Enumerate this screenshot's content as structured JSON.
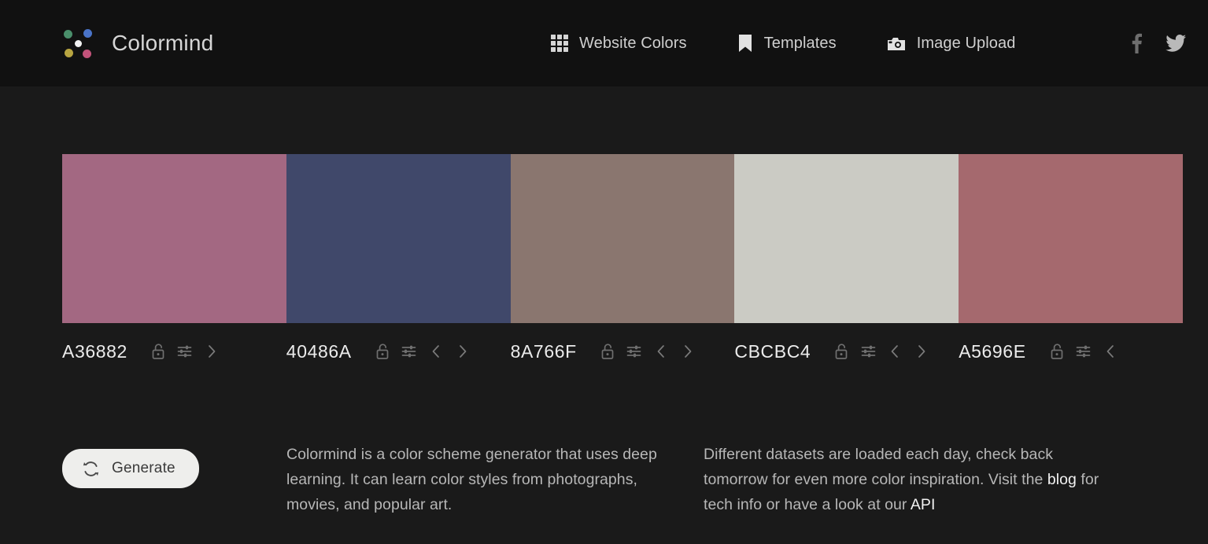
{
  "header": {
    "brand": {
      "name": "Colormind",
      "logo_icon": "colormind-dots-logo",
      "dot_colors": [
        "#4a8f6b",
        "#4a74c8",
        "#b8a541",
        "#c2537a",
        "#f2f2f2"
      ]
    },
    "nav": [
      {
        "label": "Website Colors",
        "icon": "grid-icon"
      },
      {
        "label": "Templates",
        "icon": "bookmark-icon"
      },
      {
        "label": "Image Upload",
        "icon": "camera-icon"
      }
    ],
    "social": [
      {
        "name": "facebook-icon"
      },
      {
        "name": "twitter-icon"
      }
    ],
    "background": "#111111"
  },
  "palette": {
    "swatches": [
      {
        "hex": "A36882",
        "color": "#A36882",
        "locked": false,
        "has_prev": false,
        "has_next": true
      },
      {
        "hex": "40486A",
        "color": "#40486A",
        "locked": false,
        "has_prev": true,
        "has_next": true
      },
      {
        "hex": "8A766F",
        "color": "#8A766F",
        "locked": false,
        "has_prev": true,
        "has_next": true
      },
      {
        "hex": "CBCBC4",
        "color": "#CBCBC4",
        "locked": false,
        "has_prev": true,
        "has_next": true
      },
      {
        "hex": "A5696E",
        "color": "#A5696E",
        "locked": false,
        "has_prev": true,
        "has_next": false
      }
    ],
    "controls": {
      "lock_icon": "unlock-icon",
      "adjust_icon": "sliders-icon",
      "prev_icon": "chevron-left-icon",
      "next_icon": "chevron-right-icon"
    }
  },
  "actions": {
    "generate_label": "Generate",
    "generate_icon": "refresh-icon",
    "generate_bg": "#eeeeec"
  },
  "descriptions": {
    "left": "Colormind is a color scheme generator that uses deep learning. It can learn color styles from photographs, movies, and popular art.",
    "right_part1": "Different datasets are loaded each day, check back tomorrow for even more color inspiration. Visit the ",
    "right_link1": "blog",
    "right_part2": " for tech info or have a look at our ",
    "right_link2": "API"
  },
  "theme": {
    "page_bg": "#1a1a1a",
    "text": "#b7b7b7",
    "heading": "#ececec"
  }
}
